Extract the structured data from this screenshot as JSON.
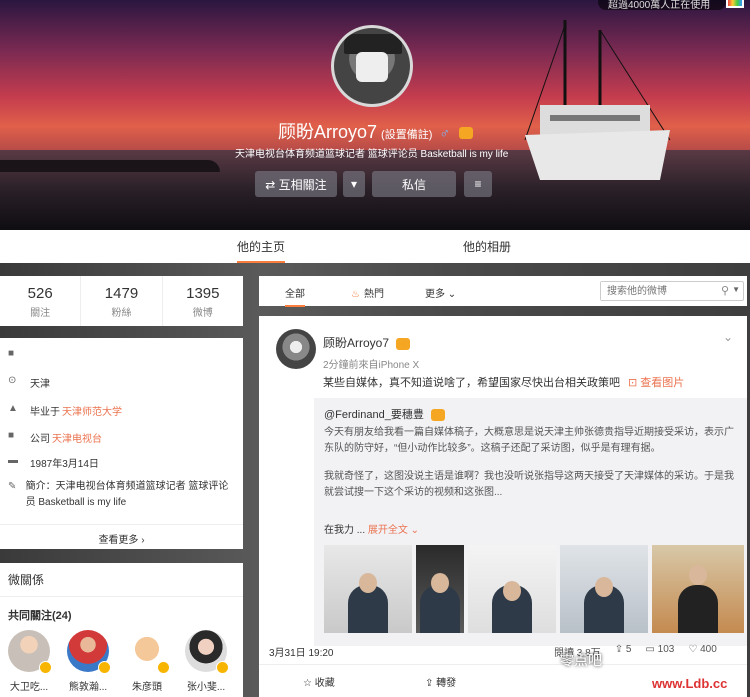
{
  "cover": {
    "online_text": "超過4000萬人正在使用"
  },
  "profile": {
    "name": "顾盼Arroyo7",
    "remark": "(設置備註)",
    "gender": "♂",
    "intro": "天津电视台体育频道篮球记者 篮球评论员 Basketball is my life",
    "buttons": {
      "follow": "⇄ 互相關注",
      "message": "私信"
    }
  },
  "tabs": {
    "home": "他的主页",
    "album": "他的相册"
  },
  "stats": [
    {
      "num": "526",
      "label": "關注"
    },
    {
      "num": "1479",
      "label": "粉絲"
    },
    {
      "num": "1395",
      "label": "微博"
    }
  ],
  "info": {
    "location": "天津",
    "edu_prefix": "毕业于",
    "edu_link": "天津师范大学",
    "work_prefix": "公司",
    "work_link": "天津电视台",
    "birthday": "1987年3月14日",
    "intro_label": "簡介：",
    "intro": "天津电视台体育频道篮球记者 篮球评论员 Basketball is my life",
    "more": "查看更多 ›"
  },
  "relations": {
    "title": "微關係",
    "common_follow": "共同關注(24)",
    "friends": [
      {
        "name": "大卫吃..."
      },
      {
        "name": "熊敦瀚..."
      },
      {
        "name": "朱彦頭"
      },
      {
        "name": "张小斐..."
      }
    ]
  },
  "filter": {
    "all": "全部",
    "hot": "熱門",
    "more": "更多 ⌄",
    "search_placeholder": "搜索他的微博"
  },
  "post": {
    "author": "顾盼Arroyo7",
    "meta": "2分鐘前來自iPhone X",
    "text": "某些自媒体，真不知道说啥了，希望国家尽快出台相关政策吧",
    "view_pic": "⊡ 查看图片",
    "repost": {
      "author": "@Ferdinand_要穗豊",
      "p1": "今天有朋友给我看一篇自媒体稿子，大概意思是说天津主帅张德贵指导近期接受采访，表示广东队的防守好，“但小动作比较多”。这稿子还配了采访图，似乎是有理有据。",
      "p2": "我就奇怪了，这图没说主语是谁啊？我也没听说张指导这两天接受了天津媒体的采访。于是我就尝试搜一下这个采访的视频和这张图...",
      "expand_prefix": "在我力 ...",
      "expand_link": "展开全文 ⌄",
      "date": "3月31日 19:20",
      "reads": "閱讀 3.8万",
      "forwards": "5",
      "comments": "103",
      "likes": "400"
    },
    "actions": {
      "fav": "☆ 收藏",
      "forward": "⇪ 轉發"
    }
  },
  "watermark": {
    "brand": "零点吧",
    "site": "www.Ldb.cc"
  }
}
